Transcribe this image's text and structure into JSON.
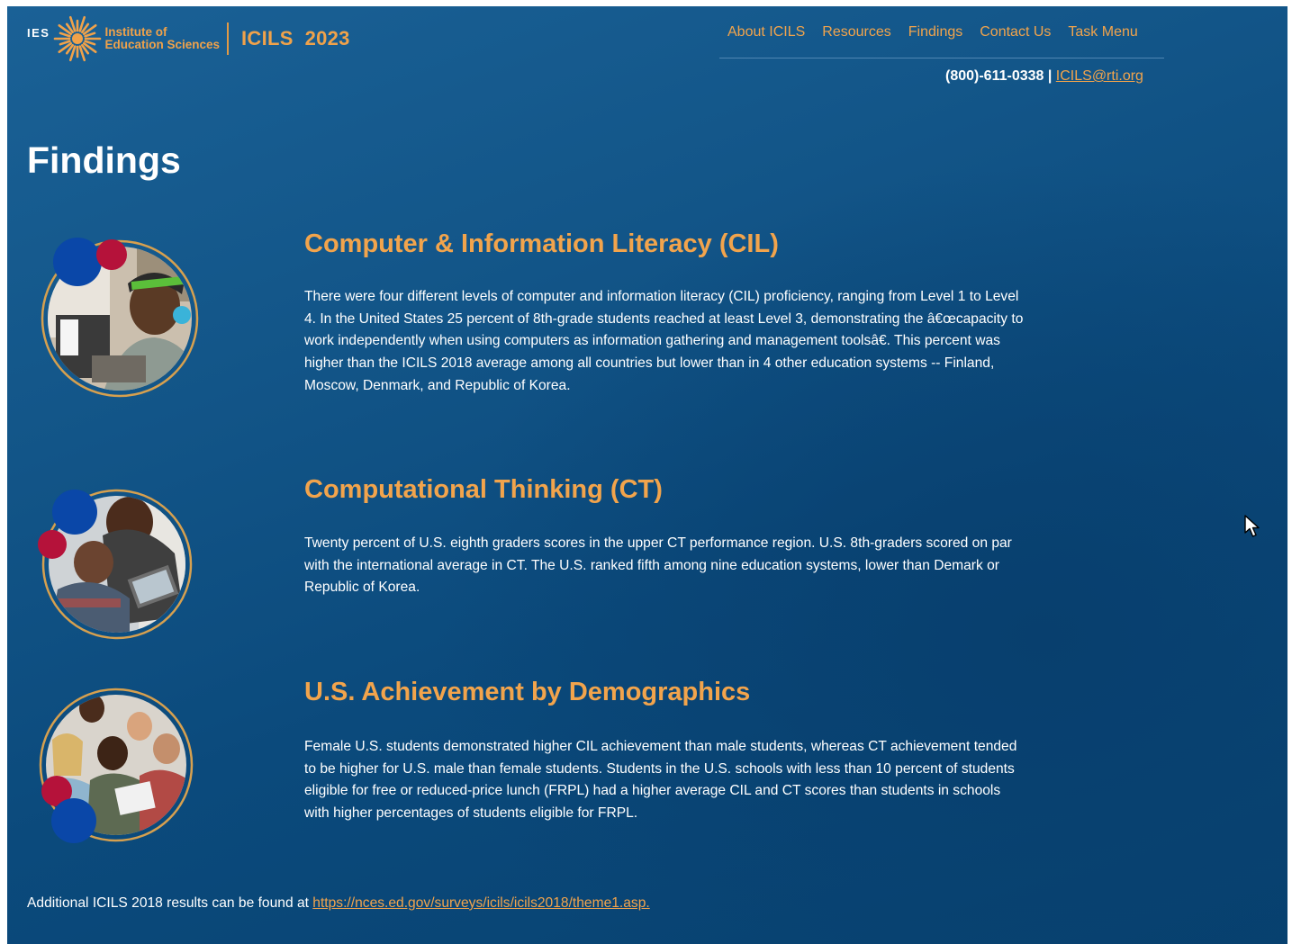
{
  "header": {
    "org_short": "IES",
    "org_line1": "Institute of",
    "org_line2": "Education Sciences",
    "site_title": "ICILS  2023"
  },
  "nav": {
    "items": [
      "About ICILS",
      "Resources",
      "Findings",
      "Contact Us",
      "Task Menu"
    ]
  },
  "contact": {
    "phone": "(800)-611-0338 |",
    "email": "ICILS@rti.org"
  },
  "page": {
    "title": "Findings"
  },
  "sections": [
    {
      "heading": "Computer & Information Literacy (CIL)",
      "body": "There were four different levels of computer and information literacy (CIL) proficiency, ranging from Level 1 to Level 4. In the United States 25 percent of 8th-grade students reached at least Level 3, demonstrating the â€œcapacity to work independently when using computers as information gathering and management toolsâ€. This percent was higher than the ICILS 2018 average among all countries but lower than in 4 other education systems -- Finland, Moscow, Denmark, and Republic of Korea.",
      "image": "student-with-headphones-photo"
    },
    {
      "heading": "Computational Thinking (CT)",
      "body": "Twenty percent of U.S. eighth graders scores in the upper CT performance region. U.S. 8th-graders scored on par with the international average in CT. The U.S. ranked fifth among nine education systems, lower than Demark or Republic of Korea.",
      "image": "teacher-with-student-photo"
    },
    {
      "heading": "U.S. Achievement by Demographics",
      "body": "Female U.S. students demonstrated higher CIL achievement than male students, whereas CT achievement tended to be higher for U.S. male than female students. Students in the U.S. schools with less than 10 percent of students eligible for free or reduced-price lunch (FRPL) had a higher average CIL and CT scores than students in schools with higher percentages of students eligible for FRPL.",
      "image": "student-group-with-tablet-photo"
    }
  ],
  "footer": {
    "text": "Additional ICILS 2018 results can be found at",
    "link": "https://nces.ed.gov/surveys/icils/icils2018/theme1.asp."
  },
  "colors": {
    "accent": "#f2a44c",
    "background": "#0f5285",
    "dot_blue": "#0a47a8",
    "dot_red": "#b5123a"
  }
}
